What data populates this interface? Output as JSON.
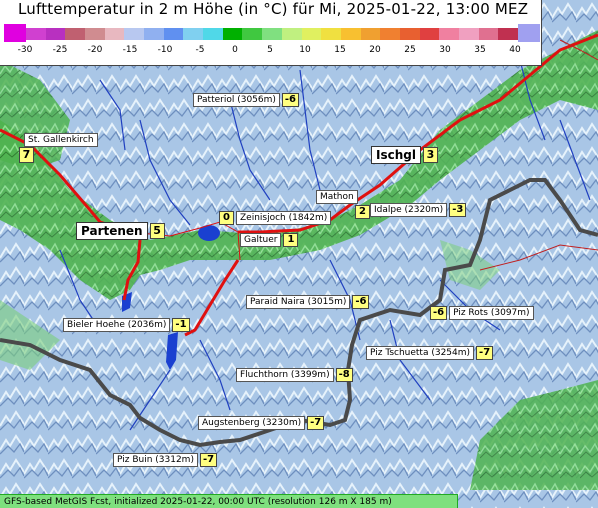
{
  "title": "Lufttemperatur in 2 m Höhe (in °C) für Mi, 2025-01-22, 13:00 MEZ",
  "scale": {
    "ticks": [
      "-30",
      "-25",
      "-20",
      "-15",
      "-10",
      "-5",
      "0",
      "5",
      "10",
      "15",
      "20",
      "25",
      "30",
      "35",
      "40"
    ],
    "colors": [
      "#e000e0",
      "#d040d0",
      "#b830c0",
      "#c06070",
      "#d08c90",
      "#e8b8c0",
      "#b8c8f0",
      "#90b0f0",
      "#6090f0",
      "#80d0f0",
      "#50d8e8",
      "#00b000",
      "#40c840",
      "#80e080",
      "#c0f080",
      "#e0f060",
      "#f0e040",
      "#f8c030",
      "#f0a030",
      "#f08030",
      "#e86030",
      "#e04040",
      "#f080a0",
      "#f0a0c0",
      "#e07090",
      "#c03050",
      "#a0a0f0"
    ]
  },
  "locations": [
    {
      "id": "patteriol",
      "name": "Patteriol (3056m)",
      "value": "-6"
    },
    {
      "id": "st-gallenkirch",
      "name": "St. Gallenkirch",
      "value": "7"
    },
    {
      "id": "ischgl",
      "name": "Ischgl",
      "value": "3"
    },
    {
      "id": "mathon",
      "name": "Mathon",
      "value": "2"
    },
    {
      "id": "idalpe",
      "name": "Idalpe (2320m)",
      "value": "-3"
    },
    {
      "id": "zeinisjoch",
      "name": "Zeinisjoch (1842m)",
      "value": "0"
    },
    {
      "id": "partenen",
      "name": "Partenen",
      "value": "5"
    },
    {
      "id": "galtuer",
      "name": "Galtuer",
      "value": "1"
    },
    {
      "id": "paraid-naira",
      "name": "Paraid Naira (3015m)",
      "value": "-6"
    },
    {
      "id": "piz-rots",
      "name": "Piz Rots (3097m)",
      "value": "-6"
    },
    {
      "id": "bieler-hoehe",
      "name": "Bieler Hoehe (2036m)",
      "value": "-1"
    },
    {
      "id": "piz-tschuetta",
      "name": "Piz Tschuetta (3254m)",
      "value": "-7"
    },
    {
      "id": "fluchthorn",
      "name": "Fluchthorn (3399m)",
      "value": "-8"
    },
    {
      "id": "augstenberg",
      "name": "Augstenberg (3230m)",
      "value": "-7"
    },
    {
      "id": "piz-buin",
      "name": "Piz Buin (3312m)",
      "value": "-7"
    }
  ],
  "footer": "GFS-based MetGIS Fcst, initialized 2025-01-22, 00:00 UTC  (resolution 126 m X 185 m)"
}
